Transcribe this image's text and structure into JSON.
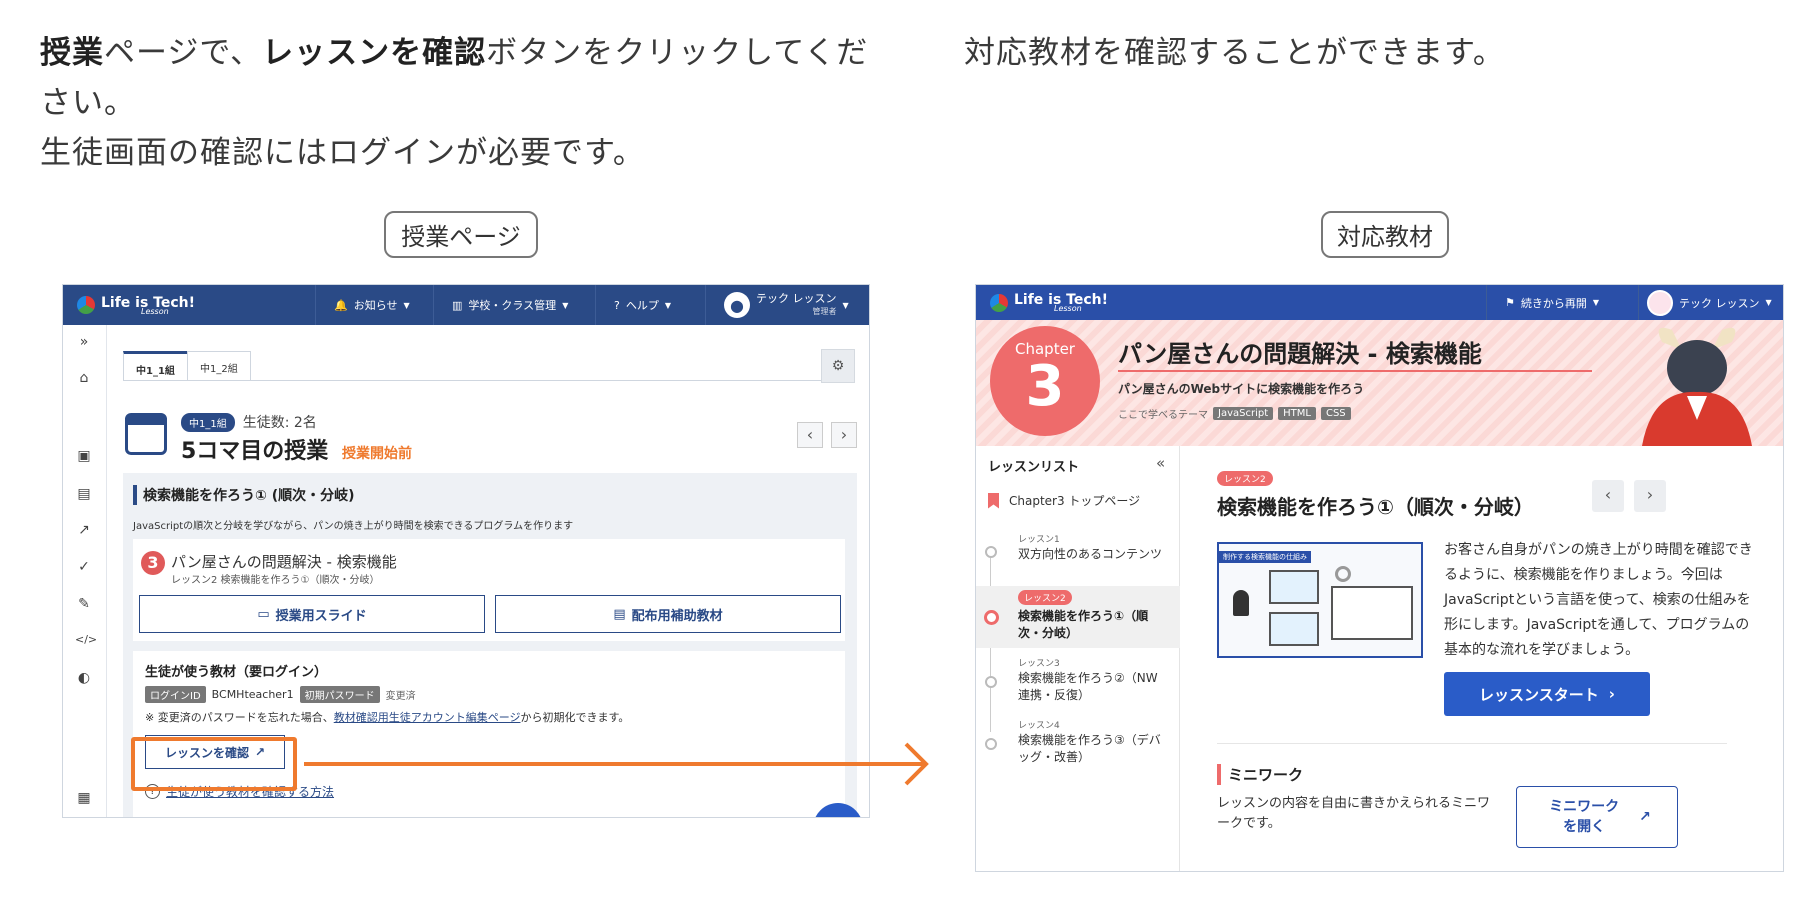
{
  "intro_left": {
    "line1_bold1": "授業",
    "line1_text1": "ページで、",
    "line1_bold2": "レッスンを確認",
    "line1_text2": "ボタンをクリックしてくだ",
    "line2": "さい。",
    "line3": "生徒画面の確認にはログインが必要です。"
  },
  "intro_right": "対応教材を確認することができます。",
  "caption_left": "授業ページ",
  "caption_right": "対応教材",
  "teacher": {
    "logo": "Life is Tech!",
    "logo_sub": "Lesson",
    "nav_notice": "お知らせ",
    "nav_school": "学校・クラス管理",
    "nav_help": "ヘルプ",
    "user_name": "テック レッスン",
    "user_role": "管理者",
    "tabs": [
      "中1_1組",
      "中1_2組"
    ],
    "class_badge": "中1_1組",
    "student_count": "生徒数: 2名",
    "lesson_title": "5コマ目の授業",
    "lesson_status": "授業開始前",
    "section_title": "検索機能を作ろう① (順次・分岐)",
    "section_desc": "JavaScriptの順次と分岐を学びながら、パンの焼き上がり時間を検索できるプログラムを作ります",
    "chapter_num": "3",
    "chapter_title": "パン屋さんの問題解決 - 検索機能",
    "chapter_sub": "レッスン2  検索機能を作ろう①（順次・分岐）",
    "slide_btn": "授業用スライド",
    "material_btn": "配布用補助教材",
    "student_title": "生徒が使う教材（要ログイン）",
    "login_id_tag": "ログインID",
    "login_id": "BCMHteacher1",
    "pw_tag": "初期パスワード",
    "pw_status": "変更済",
    "note_pre": "※ 変更済のパスワードを忘れた場合、",
    "note_link": "教材確認用生徒アカウント編集ページ",
    "note_post": "から初期化できます。",
    "confirm_btn": "レッスンを確認",
    "howto_link": "生徒が使う教材を確認する方法"
  },
  "student": {
    "logo": "Life is Tech!",
    "logo_sub": "Lesson",
    "resume": "続きから再開",
    "user_name": "テック レッスン",
    "chapter_word": "Chapter",
    "chapter_num": "3",
    "chapter_title": "パン屋さんの問題解決 - 検索機能",
    "chapter_sub": "パン屋さんのWebサイトに検索機能を作ろう",
    "theme_label": "ここで学べるテーマ",
    "theme_tags": [
      "JavaScript",
      "HTML",
      "CSS"
    ],
    "list_title": "レッスンリスト",
    "top_page": "Chapter3 トップページ",
    "lessons": [
      {
        "num": "レッスン1",
        "title": "双方向性のあるコンテンツ"
      },
      {
        "num": "レッスン2",
        "title": "検索機能を作ろう①（順次・分岐）"
      },
      {
        "num": "レッスン3",
        "title": "検索機能を作ろう②（NW連携・反復）"
      },
      {
        "num": "レッスン4",
        "title": "検索機能を作ろう③（デバッグ・改善）"
      }
    ],
    "lesson_badge": "レッスン2",
    "lesson_title": "検索機能を作ろう①（順次・分岐）",
    "diagram_caption": "制作する検索機能の仕組み",
    "lesson_desc": "お客さん自身がパンの焼き上がり時間を確認できるように、検索機能を作りましょう。今回はJavaScriptという言語を使って、検索の仕組みを形にします。JavaScriptを通して、プログラムの基本的な流れを学びましょう。",
    "start_btn": "レッスンスタート",
    "miniwork_title": "ミニワーク",
    "miniwork_desc": "レッスンの内容を自由に書きかえられるミニワークです。",
    "miniwork_btn": "ミニワークを開く"
  },
  "colors": {
    "navy": "#2a4a86",
    "orange": "#ef7a2e",
    "red": "#e05a5a",
    "blue_btn": "#2a5cc8"
  }
}
